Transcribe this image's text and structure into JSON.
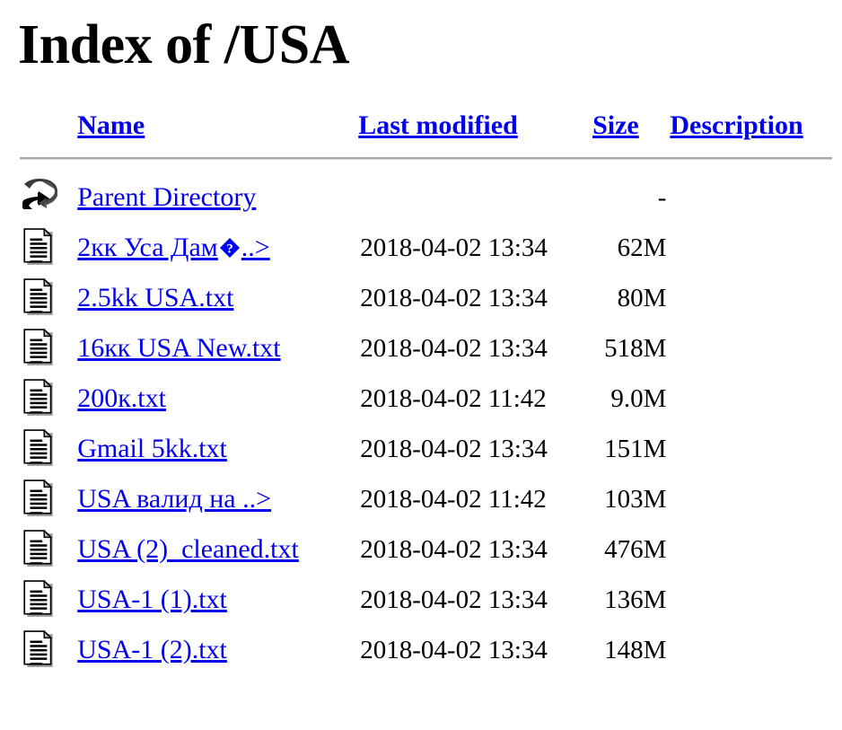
{
  "page": {
    "title": "Index of /USA",
    "link_color": "#0000ee",
    "text_color": "#000000",
    "background_color": "#ffffff",
    "rule_color": "#a9a9a9"
  },
  "columns": {
    "icon": "",
    "name": "Name",
    "last_modified": "Last modified",
    "size": "Size",
    "description": "Description"
  },
  "rows": [
    {
      "icon": "back-icon",
      "name_prefix": "Parent Directory",
      "name_has_replacement": false,
      "name_suffix": "",
      "last_modified": "",
      "size": "-",
      "description": ""
    },
    {
      "icon": "text-file-icon",
      "name_prefix": "2кк Уса Дам",
      "name_has_replacement": true,
      "name_suffix": "..>",
      "last_modified": "2018-04-02 13:34",
      "size": "62M",
      "description": ""
    },
    {
      "icon": "text-file-icon",
      "name_prefix": "2.5kk USA.txt",
      "name_has_replacement": false,
      "name_suffix": "",
      "last_modified": "2018-04-02 13:34",
      "size": "80M",
      "description": ""
    },
    {
      "icon": "text-file-icon",
      "name_prefix": "16кк USA New.txt",
      "name_has_replacement": false,
      "name_suffix": "",
      "last_modified": "2018-04-02 13:34",
      "size": "518M",
      "description": ""
    },
    {
      "icon": "text-file-icon",
      "name_prefix": "200к.txt",
      "name_has_replacement": false,
      "name_suffix": "",
      "last_modified": "2018-04-02 11:42",
      "size": "9.0M",
      "description": ""
    },
    {
      "icon": "text-file-icon",
      "name_prefix": "Gmail 5kk.txt",
      "name_has_replacement": false,
      "name_suffix": "",
      "last_modified": "2018-04-02 13:34",
      "size": "151M",
      "description": ""
    },
    {
      "icon": "text-file-icon",
      "name_prefix": "USA валид на ..>",
      "name_has_replacement": false,
      "name_suffix": "",
      "last_modified": "2018-04-02 11:42",
      "size": "103M",
      "description": ""
    },
    {
      "icon": "text-file-icon",
      "name_prefix": "USA (2)_cleaned.txt",
      "name_has_replacement": false,
      "name_suffix": "",
      "last_modified": "2018-04-02 13:34",
      "size": "476M",
      "description": ""
    },
    {
      "icon": "text-file-icon",
      "name_prefix": "USA-1 (1).txt",
      "name_has_replacement": false,
      "name_suffix": "",
      "last_modified": "2018-04-02 13:34",
      "size": "136M",
      "description": ""
    },
    {
      "icon": "text-file-icon",
      "name_prefix": "USA-1 (2).txt",
      "name_has_replacement": false,
      "name_suffix": "",
      "last_modified": "2018-04-02 13:34",
      "size": "148M",
      "description": ""
    }
  ]
}
